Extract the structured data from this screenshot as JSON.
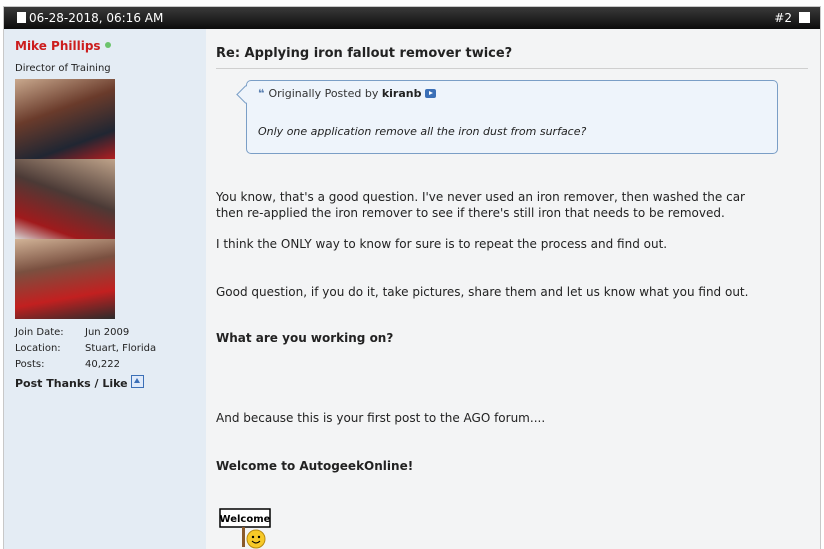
{
  "post": {
    "date": "06-28-2018, 06:16 AM",
    "number": "#2",
    "title": "Re: Applying iron fallout remover twice?"
  },
  "user": {
    "name": "Mike Phillips",
    "title": "Director of Training",
    "join_date_label": "Join Date:",
    "join_date": "Jun 2009",
    "location_label": "Location:",
    "location": "Stuart, Florida",
    "posts_label": "Posts:",
    "posts": "40,222",
    "thanks_label": "Post Thanks / Like"
  },
  "quote": {
    "prefix": "Originally Posted by",
    "author": "kiranb",
    "text": "Only one application remove all the iron dust from surface?"
  },
  "message": {
    "p1_line1": "You know, that's a good question. I've never used an iron remover, then washed the car",
    "p1_line2": "then re-applied the iron remover to see if there's still iron that needs to be removed.",
    "p2": "I think the ONLY way to know for sure is to repeat the process and find out.",
    "p3": "Good question, if you do it, take pictures, share them and let us know what you find out.",
    "p4": "What are you working on?",
    "p5": "And because this is your first post to the AGO forum....",
    "p6": "Welcome to AutogeekOnline!",
    "sign_text": "Welcome"
  },
  "colors": {
    "username": "#cc1d1d",
    "sidebar_bg": "#e4ecf4",
    "header_bg": "#111111",
    "quote_border": "#7a9ec6"
  }
}
